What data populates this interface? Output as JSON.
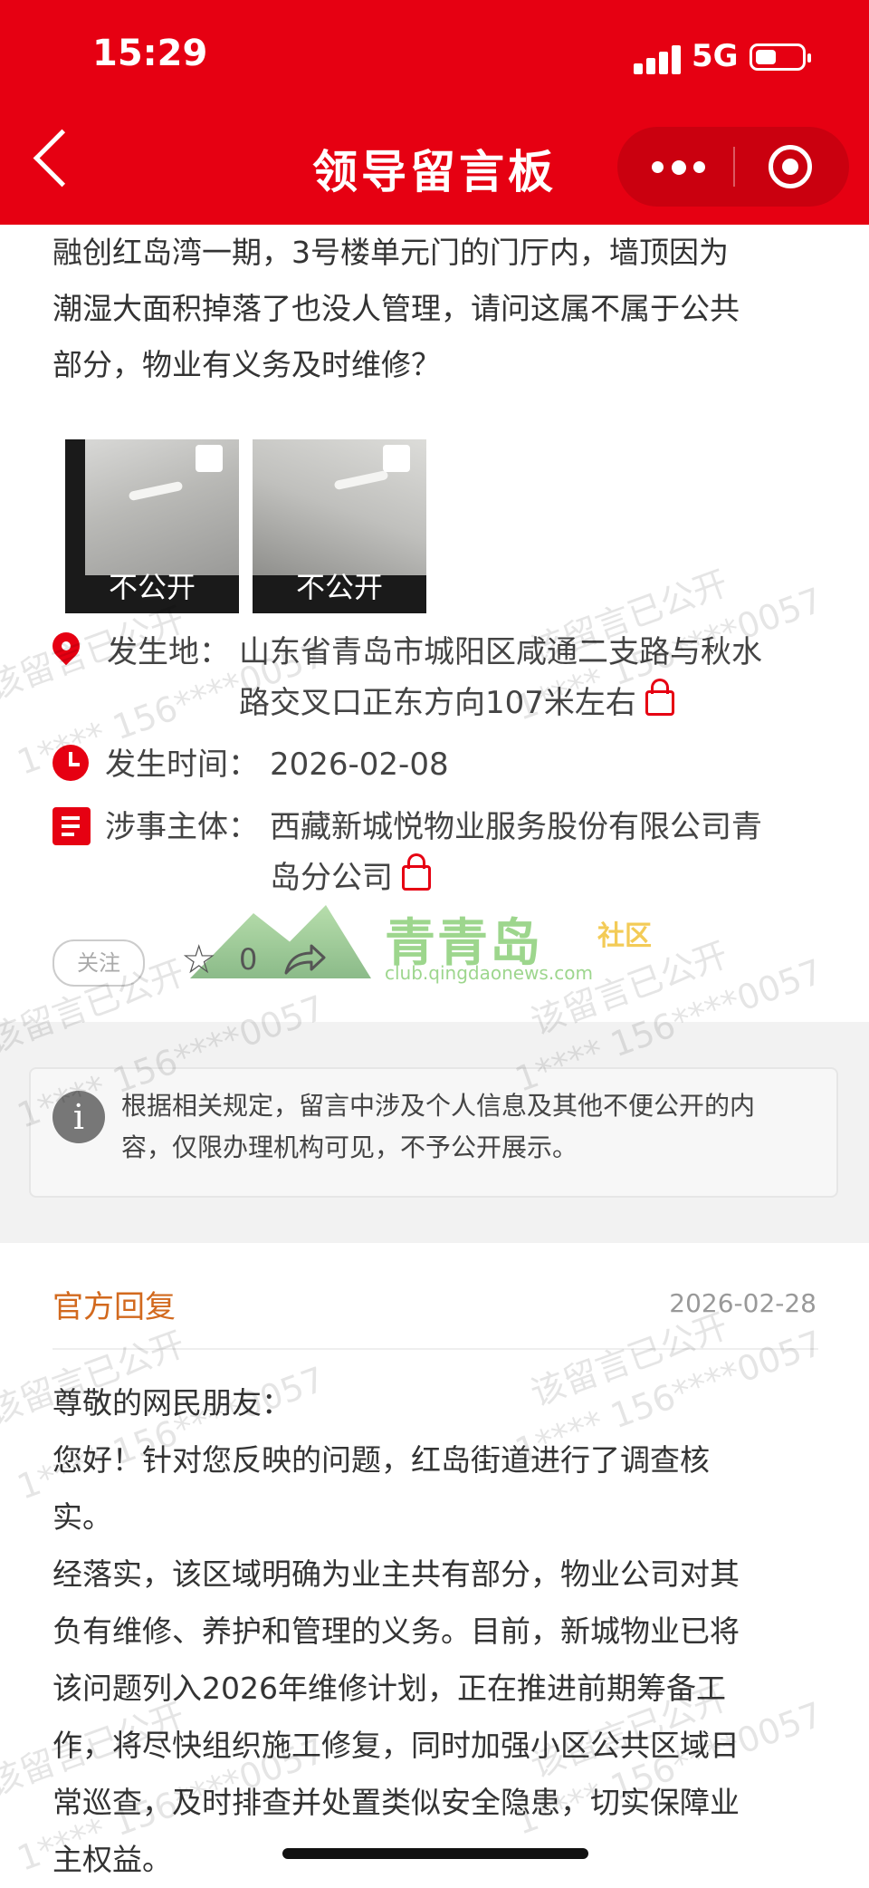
{
  "status_bar": {
    "time": "15:29",
    "network": "5G"
  },
  "nav": {
    "title": "领导留言板"
  },
  "message": {
    "lines": [
      "融创红岛湾一期，3号楼单元门的门厅内，墙顶因为",
      "潮湿大面积掉落了也没人管理，请问这属不属于公共",
      "部分，物业有义务及时维修？"
    ],
    "images": [
      {
        "tag": "不公开"
      },
      {
        "tag": "不公开"
      }
    ]
  },
  "details": {
    "location_label": "发生地：",
    "location_line1": "山东省青岛市城阳区咸通二支路与秋水",
    "location_line2": "路交叉口正东方向107米左右",
    "time_label": "发生时间：",
    "time_value": "2026-02-08",
    "subject_label": "涉事主体：",
    "subject_line1": "西藏新城悦物业服务股份有限公司青",
    "subject_line2": "岛分公司"
  },
  "actions": {
    "follow": "关注",
    "like_count": "0"
  },
  "logo": {
    "name": "青青岛",
    "sub": "社区",
    "url": "club.qingdaonews.com"
  },
  "notice": {
    "line1": "根据相关规定，留言中涉及个人信息及其他不便公开的内",
    "line2": "容，仅限办理机构可见，不予公开展示。"
  },
  "reply": {
    "title": "官方回复",
    "date": "2026-02-28",
    "lines": [
      "尊敬的网民朋友：",
      "您好！针对您反映的问题，红岛街道进行了调查核",
      "实。",
      "经落实，该区域明确为业主共有部分，物业公司对其",
      "负有维修、养护和管理的义务。目前，新城物业已将",
      "该问题列入2026年维修计划，正在推进前期筹备工",
      "作，将尽快组织施工修复，同时加强小区公共区域日",
      "常巡查，及时排查并处置类似安全隐患，切实保障业",
      "主权益。"
    ]
  },
  "watermark": {
    "text1": "该留言已公开",
    "text2": "1**** 156****0057"
  },
  "colors": {
    "brand_red": "#e60012",
    "reply_title": "#d2691e"
  }
}
